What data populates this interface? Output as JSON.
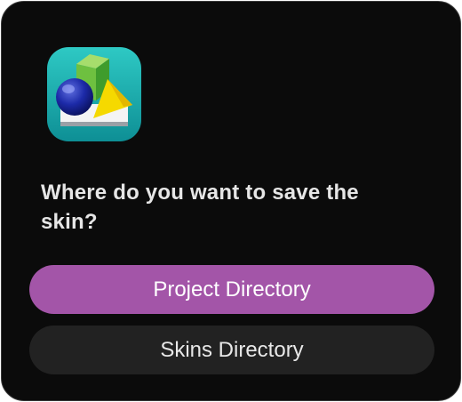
{
  "dialog": {
    "icon": "skin-editor-app-icon",
    "message": "Where do you want to save the skin?",
    "buttons": {
      "project_label": "Project Directory",
      "skins_label": "Skins Directory"
    }
  },
  "colors": {
    "background": "#0b0b0b",
    "primary_button": "#a355a8",
    "secondary_button": "#222222",
    "message_text": "#e6e6e6"
  }
}
